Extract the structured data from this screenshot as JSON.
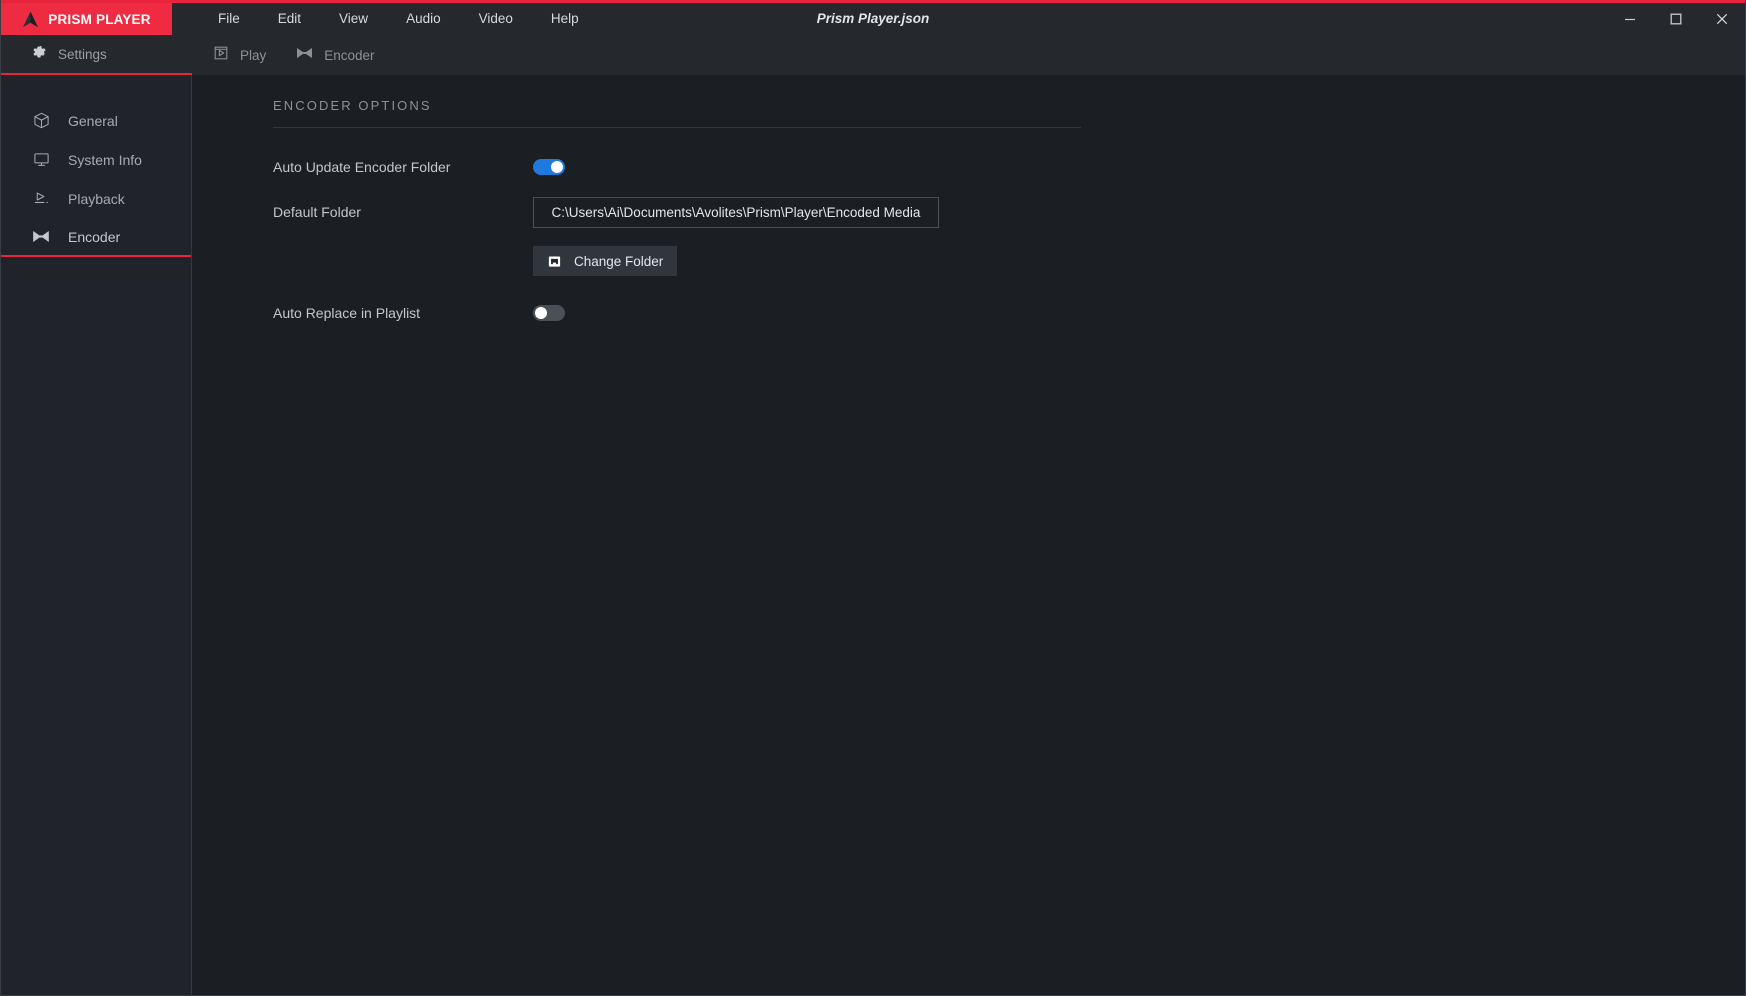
{
  "window": {
    "document_title": "Prism Player.json",
    "accent_color": "#e8243c",
    "controls": {
      "minimize": "minimize-button",
      "maximize": "maximize-button",
      "close": "close-button"
    }
  },
  "brand": {
    "name": "PRISM PLAYER",
    "logo_icon": "prism-logo-icon",
    "background_color": "#ef2b42"
  },
  "menubar": {
    "items": [
      {
        "label": "File"
      },
      {
        "label": "Edit"
      },
      {
        "label": "View"
      },
      {
        "label": "Audio"
      },
      {
        "label": "Video"
      },
      {
        "label": "Help"
      }
    ]
  },
  "toolbar": {
    "tabs": [
      {
        "label": "Settings",
        "icon": "gear-icon",
        "active": true
      },
      {
        "label": "Play",
        "icon": "play-box-icon",
        "active": false
      },
      {
        "label": "Encoder",
        "icon": "bowtie-icon",
        "active": false
      }
    ]
  },
  "sidebar": {
    "items": [
      {
        "label": "General",
        "icon": "cube-icon",
        "active": false
      },
      {
        "label": "System Info",
        "icon": "monitor-icon",
        "active": false
      },
      {
        "label": "Playback",
        "icon": "playback-icon",
        "active": false
      },
      {
        "label": "Encoder",
        "icon": "bowtie-icon",
        "active": true
      }
    ]
  },
  "main": {
    "section_title": "ENCODER OPTIONS",
    "rows": {
      "auto_update": {
        "label": "Auto Update Encoder Folder",
        "toggle_state": "on",
        "toggle_color": "#1f7ae0"
      },
      "default_folder": {
        "label": "Default Folder",
        "value": "C:\\Users\\Ai\\Documents\\Avolites\\Prism\\Player\\Encoded Media",
        "placeholder": "Folder path"
      },
      "change_folder": {
        "label": "Change Folder",
        "icon": "folder-open-icon"
      },
      "auto_replace": {
        "label": "Auto Replace in Playlist",
        "toggle_state": "off",
        "toggle_color": "#4b5058"
      }
    }
  }
}
